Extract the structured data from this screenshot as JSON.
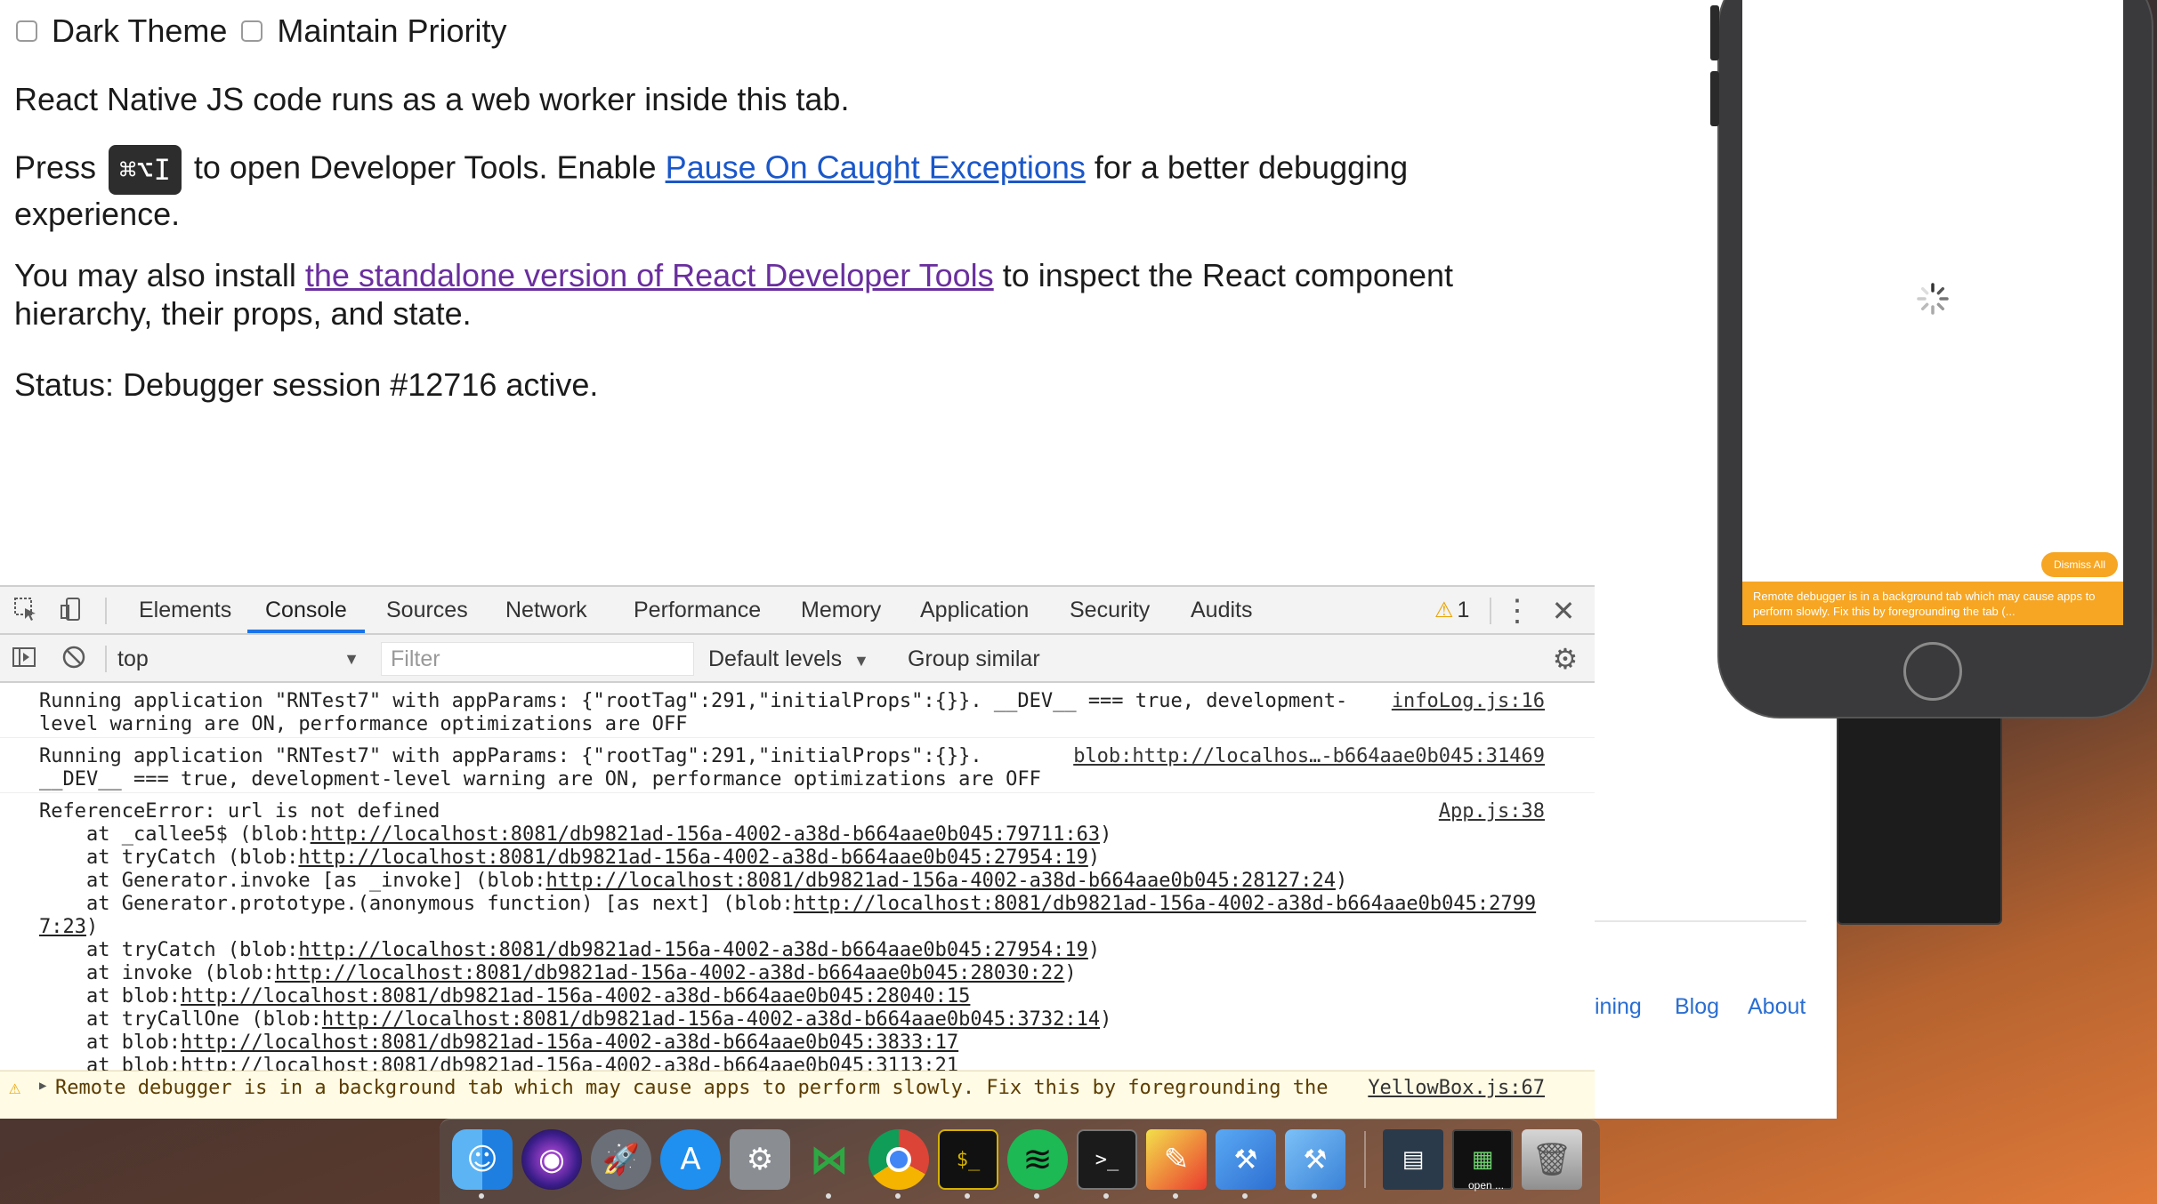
{
  "page": {
    "dark_theme_label": "Dark Theme",
    "maintain_priority_label": "Maintain Priority",
    "para1": "React Native JS code runs as a web worker inside this tab.",
    "para2_prefix": "Press",
    "para2_shortcut": "⌘⌥I",
    "para2_mid": "to open Developer Tools. Enable",
    "para2_link": "Pause On Caught Exceptions",
    "para2_suffix": "for a better debugging experience.",
    "para3_prefix": "You may also install",
    "para3_link": "the standalone version of React Developer Tools",
    "para3_suffix": "to inspect the React component hierarchy, their props, and state.",
    "status": "Status: Debugger session #12716 active."
  },
  "devtools": {
    "tabs": [
      "Elements",
      "Console",
      "Sources",
      "Network",
      "Performance",
      "Memory",
      "Application",
      "Security",
      "Audits"
    ],
    "active_tab": "Console",
    "warning_count": "1",
    "context": "top",
    "filter_placeholder": "Filter",
    "levels": "Default levels",
    "group_similar": "Group similar"
  },
  "console": {
    "msg1_line1": "Running application \"RNTest7\" with appParams: {\"rootTag\":291,\"initialProps\":{}}. __DEV__ === true, development-",
    "msg1_line2": "level warning are ON, performance optimizations are OFF",
    "msg1_src": "infoLog.js:16",
    "msg2_line1": "Running application \"RNTest7\" with appParams: {\"rootTag\":291,\"initialProps\":{}}.",
    "msg2_line2": "__DEV__ === true, development-level warning are ON, performance optimizations are OFF",
    "msg2_src": "blob:http://localhos…-b664aae0b045:31469",
    "err_head": "ReferenceError: url is not defined",
    "err_src": "App.js:38",
    "stack": [
      {
        "pre": "    at _callee5$ (blob:",
        "url": "http://localhost:8081/db9821ad-156a-4002-a38d-b664aae0b045:79711:63",
        "post": ")"
      },
      {
        "pre": "    at tryCatch (blob:",
        "url": "http://localhost:8081/db9821ad-156a-4002-a38d-b664aae0b045:27954:19",
        "post": ")"
      },
      {
        "pre": "    at Generator.invoke [as _invoke] (blob:",
        "url": "http://localhost:8081/db9821ad-156a-4002-a38d-b664aae0b045:28127:24",
        "post": ")"
      },
      {
        "pre": "    at Generator.prototype.(anonymous function) [as next] (blob:",
        "url": "http://localhost:8081/db9821ad-156a-4002-a38d-b664aae0b045:2799",
        "post": ""
      },
      {
        "pre": "",
        "url": "7:23",
        "post": ")"
      },
      {
        "pre": "    at tryCatch (blob:",
        "url": "http://localhost:8081/db9821ad-156a-4002-a38d-b664aae0b045:27954:19",
        "post": ")"
      },
      {
        "pre": "    at invoke (blob:",
        "url": "http://localhost:8081/db9821ad-156a-4002-a38d-b664aae0b045:28030:22",
        "post": ")"
      },
      {
        "pre": "    at blob:",
        "url": "http://localhost:8081/db9821ad-156a-4002-a38d-b664aae0b045:28040:15",
        "post": ""
      },
      {
        "pre": "    at tryCallOne (blob:",
        "url": "http://localhost:8081/db9821ad-156a-4002-a38d-b664aae0b045:3732:14",
        "post": ")"
      },
      {
        "pre": "    at blob:",
        "url": "http://localhost:8081/db9821ad-156a-4002-a38d-b664aae0b045:3833:17",
        "post": ""
      },
      {
        "pre": "    at blob:",
        "url": "http://localhost:8081/db9821ad-156a-4002-a38d-b664aae0b045:3113:21",
        "post": ""
      }
    ],
    "warn_text": "Remote debugger is in a background tab which may cause apps to perform slowly. Fix this by foregrounding the",
    "warn_src": "YellowBox.js:67"
  },
  "background_browser": {
    "links": [
      "ining",
      "Blog",
      "About"
    ]
  },
  "simulator": {
    "dismiss_all": "Dismiss All",
    "yellowbox_text": "Remote debugger is in a background tab which may cause apps to perform slowly. Fix this by foregrounding the tab (..."
  },
  "dock": {
    "apps": [
      "finder-icon",
      "siri-icon",
      "launchpad-icon",
      "app-store-icon",
      "system-preferences-icon",
      "visual-studio-code-icon",
      "chrome-icon",
      "terminal-icon",
      "spotify-icon",
      "terminal-icon",
      "preview-icon",
      "xcode-icon",
      "simulator-icon",
      "downloads-stack-icon",
      "open-stack-icon",
      "trash-icon"
    ],
    "open_label": "open ..."
  },
  "colors": {
    "link": "#1a57c9",
    "visited_link": "#6a2f9e",
    "active_tab_underline": "#1a73e8",
    "warning": "#e8a400",
    "yellowbox": "#f6a623"
  }
}
